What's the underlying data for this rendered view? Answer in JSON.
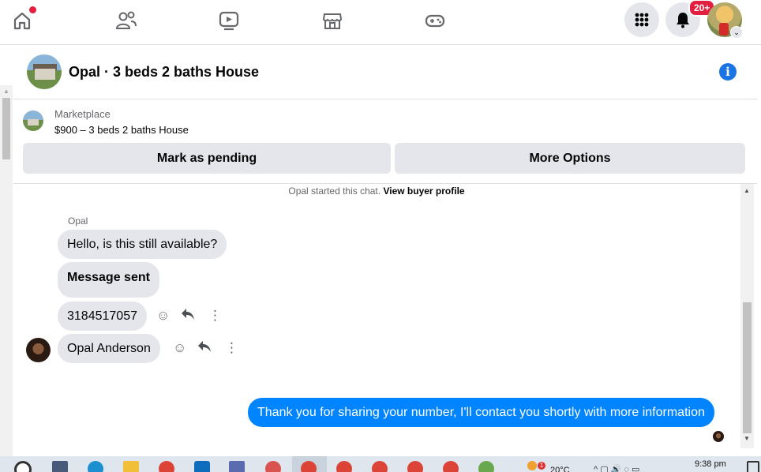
{
  "nav": {
    "icons": [
      "home-icon",
      "friends-icon",
      "watch-icon",
      "marketplace-icon",
      "gaming-icon"
    ],
    "menu_icon": "grid-menu-icon",
    "notif_icon": "bell-icon",
    "notif_badge": "20+",
    "avatar_caret": "⌄"
  },
  "chat": {
    "title": "Opal · 3 beds 2 baths House",
    "info_icon": "i"
  },
  "marketplace": {
    "label": "Marketplace",
    "listing": "$900 – 3 beds 2 baths House",
    "mark_pending_label": "Mark as pending",
    "more_options_label": "More Options"
  },
  "conversation": {
    "started_text": "Opal started this chat.",
    "buyer_profile_link": "View buyer profile",
    "sender_name": "Opal",
    "messages_in": [
      "Hello, is this still available?",
      "Message sent",
      "3184517057",
      "Opal Anderson"
    ],
    "message_out": "Thank you for sharing your number, I'll contact you shortly with more information"
  },
  "taskbar": {
    "temperature": "20°C",
    "time": "9:38 pm",
    "weather_badge": "1"
  },
  "colors": {
    "accent": "#1b74e4",
    "outgoing_bubble": "#0084ff",
    "incoming_bubble": "#e4e6eb",
    "badge": "#e41e3f"
  }
}
